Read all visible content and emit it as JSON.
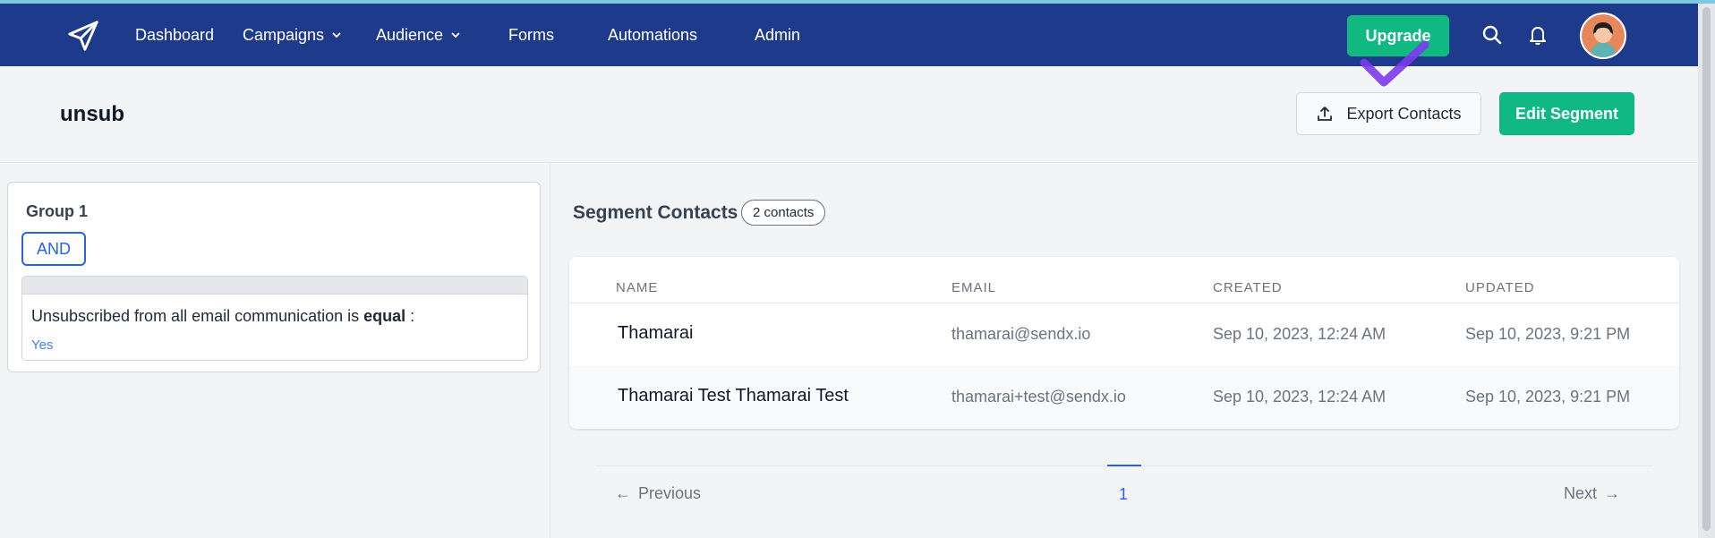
{
  "nav": {
    "items": [
      {
        "label": "Dashboard",
        "has_dropdown": false
      },
      {
        "label": "Campaigns",
        "has_dropdown": true
      },
      {
        "label": "Audience",
        "has_dropdown": true
      },
      {
        "label": "Forms",
        "has_dropdown": false
      },
      {
        "label": "Automations",
        "has_dropdown": false
      },
      {
        "label": "Admin",
        "has_dropdown": false
      }
    ],
    "upgrade_label": "Upgrade",
    "icons": [
      "paper-plane-logo-icon",
      "search-icon",
      "bell-icon",
      "avatar"
    ]
  },
  "header": {
    "title": "unsub",
    "export_label": "Export Contacts",
    "edit_label": "Edit Segment"
  },
  "group": {
    "title": "Group 1",
    "operator": "AND",
    "condition": {
      "prefix": "Unsubscribed from all email communication is",
      "op": "equal",
      "suffix": " :",
      "value": "Yes"
    }
  },
  "segment": {
    "title": "Segment Contacts",
    "count_badge": "2 contacts",
    "columns": [
      "NAME",
      "EMAIL",
      "CREATED",
      "UPDATED"
    ],
    "rows": [
      {
        "name": "Thamarai",
        "email": "thamarai@sendx.io",
        "created": "Sep 10, 2023, 12:24 AM",
        "updated": "Sep 10, 2023, 9:21 PM"
      },
      {
        "name": "Thamarai Test Thamarai Test",
        "email": "thamarai+test@sendx.io",
        "created": "Sep 10, 2023, 12:24 AM",
        "updated": "Sep 10, 2023, 9:21 PM"
      }
    ]
  },
  "pagination": {
    "prev_label": "Previous",
    "next_label": "Next",
    "current_page": "1"
  },
  "colors": {
    "navbar": "#1e3a8a",
    "accent_green": "#10b981",
    "accent_blue": "#2563eb"
  }
}
